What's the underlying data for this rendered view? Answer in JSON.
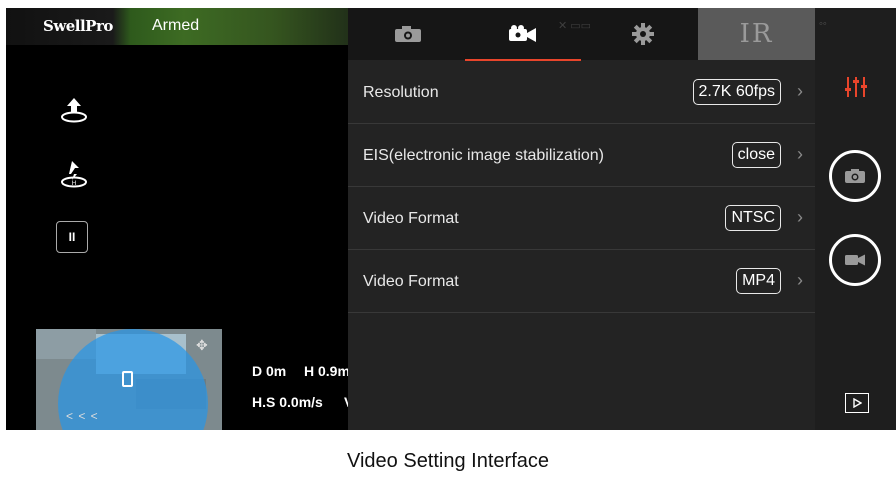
{
  "app": {
    "brand": "SwellPro",
    "status": "Armed"
  },
  "tabs": [
    {
      "name": "photo-settings",
      "icon": "camera-icon"
    },
    {
      "name": "video-settings",
      "icon": "video-camera-icon",
      "active": true
    },
    {
      "name": "general-settings",
      "icon": "gear-icon"
    },
    {
      "name": "ir",
      "label": "IR"
    }
  ],
  "settings": {
    "rows": [
      {
        "label": "Resolution",
        "value": "2.7K 60fps"
      },
      {
        "label": "EIS(electronic image stabilization)",
        "value": "close"
      },
      {
        "label": "Video Format",
        "value": "NTSC"
      },
      {
        "label": "Video Format",
        "value": "MP4"
      }
    ]
  },
  "telemetry": {
    "distance": "D 0m",
    "height": "H 0.9m",
    "hspeed": "H.S 0.0m/s",
    "vspeed": "V"
  },
  "controls": {
    "pause_label": "II"
  },
  "caption": "Video Setting Interface",
  "colors": {
    "accent": "#e8452b",
    "armed_bar": "#3d6b23",
    "map_overlay": "#2896e6"
  }
}
